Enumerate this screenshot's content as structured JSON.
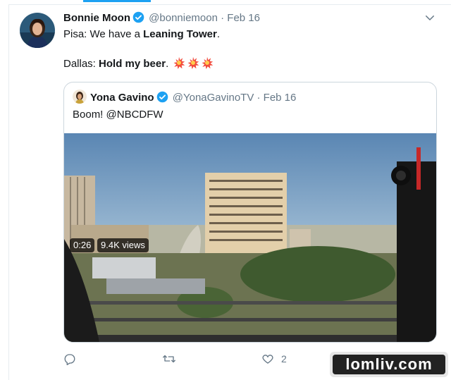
{
  "tweet": {
    "author_name": "Bonnie Moon",
    "author_handle": "@bonniemoon",
    "separator": "·",
    "date": "Feb 16",
    "line1": {
      "prefix": "Pisa: We have a ",
      "bold": "Leaning Tower",
      "suffix": "."
    },
    "line2": {
      "prefix": "Dallas: ",
      "bold": "Hold my beer",
      "suffix": "."
    },
    "emoji": [
      "collision-icon",
      "collision-icon",
      "collision-icon"
    ]
  },
  "quoted": {
    "author_name": "Yona Gavino",
    "author_handle": "@YonaGavinoTV",
    "separator": "·",
    "date": "Feb 16",
    "text": "Boom! @NBCDFW",
    "video": {
      "duration": "0:26",
      "views": "9.4K views"
    }
  },
  "actions": {
    "reply_count": "",
    "retweet_count": "",
    "like_count": "2",
    "share_count": ""
  },
  "watermark": {
    "text": "lomliv.com"
  },
  "colors": {
    "accent": "#1da1f2",
    "muted": "#657786",
    "border": "#ccd6dd"
  }
}
